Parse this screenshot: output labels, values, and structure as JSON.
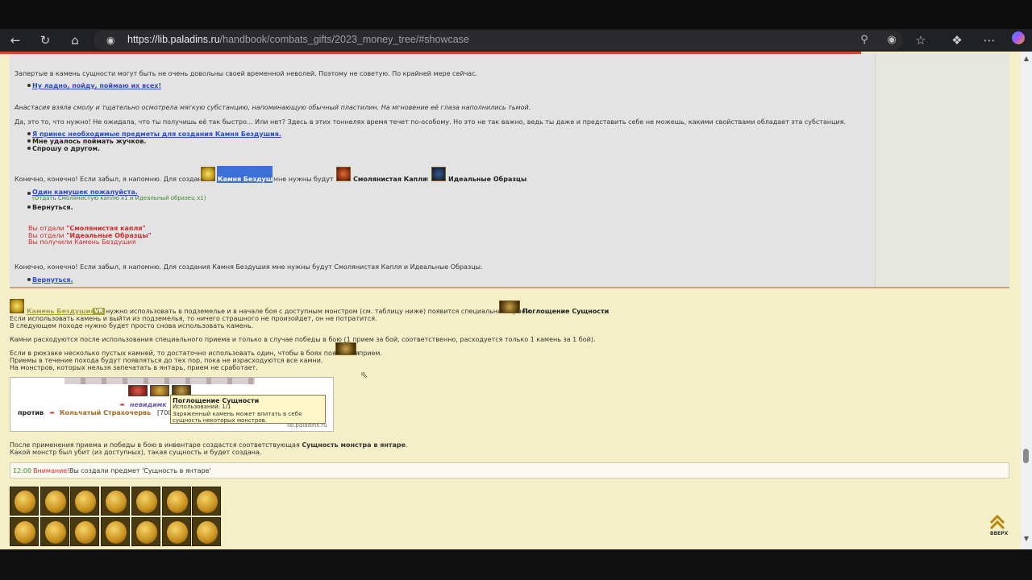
{
  "browser": {
    "url_host": "https://lib.paladins.ru",
    "url_path": "/handbook/combats_gifts/2023_money_tree/#showcase",
    "icons": [
      "back-icon",
      "reload-icon",
      "home-icon",
      "info-icon",
      "zoom-icon",
      "read-aloud-icon",
      "favorite-icon",
      "extensions-icon",
      "more-icon",
      "copilot-icon"
    ]
  },
  "dialog": {
    "p1": "Запертые в камень сущности могут быть не очень довольны своей временной неволей. Поэтому не советую. По крайней мере сейчас.",
    "opt1": "Ну ладно, пойду, поймаю их всех!",
    "p2": "Анастасия взяла смолу и тщательно осмотрела мягкую субстанцию, напоминающую обычный пластилин. На мгновение её глаза наполнились тьмой.",
    "p3": "Да, это то, что нужно! Не ожидала, что ты получишь её так быстро... Или нет? Здесь в этих тоннелях время течет по-особому. Но это не так важно, ведь ты даже и представить себе не можешь, какими свойствами обладает эта субстанция.",
    "opt2": "Я принес необходимые предметы для создания Камня Бездушия.",
    "opt3": "Мне удалось поймать жучков.",
    "opt4": "Спрошу о другом.",
    "p4a": "Конечно, конечно! Если забыл, я напомню. Для создания",
    "p4_item1": "Камня Бездушия",
    "p4b": "мне нужны будут",
    "p4_item2": "Смолянистая Капля",
    "p4_and": "и",
    "p4_item3": "Идеальные Образцы",
    "p4_dot": ".",
    "opt5": "Один камушек пожалуйста.",
    "opt5_note": "(Отдать Смолянистую каплю x1 и Идеальный образец x1)",
    "opt6": "Вернуться.",
    "gave1_pre": "Вы отдали",
    "gave1": "\"Смолянистая капля\"",
    "gave2_pre": "Вы отдали",
    "gave2": "\"Идеальные Образцы\"",
    "got": "Вы получили Камень Бездушия",
    "p5": "Конечно, конечно! Если забыл, я напомню. Для создания Камня Бездушия мне нужны будут Смолянистая Капля и Идеальные Образцы.",
    "opt7": "Вернуться."
  },
  "info": {
    "stone_name": "Камень Бездушия",
    "stone_badge": "VR",
    "l1a": "нужно использовать в подземелье и в начале боя с доступным монстром (см. таблицу ниже) появится специальный прием",
    "l1_skill": "Поглощение Сущности",
    "l1_dot": ".",
    "l2": "Если использовать камень и выйти из подземелья, то ничего страшного не произойдет, он не потратится.",
    "l3": "В следующем походе нужно будет просто снова использовать камень.",
    "l4": "Камни расходуются после использования специального приема и только в случае победы в бою (1 прием за бой, соответственно, расходуется только 1 камень за 1 бой).",
    "l5a": "Если в рюкзаке несколько пустых камней, то достаточно использовать один, чтобы в боях появлялся",
    "l5b": "прием.",
    "l6": "Приемы в течение похода будут появляться до тех пор, пока не израсходуются все камни.",
    "l7": "На монстров, которых нельзя запечатать в янтарь, прием не сработает.",
    "l8a": "После применения приема и победы в бою в инвентаре создастся соответствующая",
    "l8_bold": "Сущность монстра в янтаре",
    "l8_dot": ".",
    "l9": "Какой монстр был убит (из доступных), такая сущность и будет создана."
  },
  "battle": {
    "vs": "против",
    "invisible": "невидимк",
    "enemy": "Кольчатый Страхочервь",
    "enemy_hp": "[700",
    "watermark": "lib.paladins.ru",
    "tip_title": "Поглощение Сущности",
    "tip_uses": "Использований: 1/1",
    "tip_desc1": "Заряженный камень может впитать в себя",
    "tip_desc2": "сущность некоторых монстров."
  },
  "notice": {
    "time": "12:00",
    "label": "Внимание!",
    "text": "Вы создали предмет 'Сущность в янтаре'"
  },
  "backtop": {
    "label": "ВВЕРХ"
  },
  "colors": {
    "page_bg": "#f4efc6",
    "dialog_bg": "#e3e3e3",
    "link": "#2b4fc2",
    "accent_red": "#d02c2c",
    "accent_green": "#3a8b2a"
  }
}
